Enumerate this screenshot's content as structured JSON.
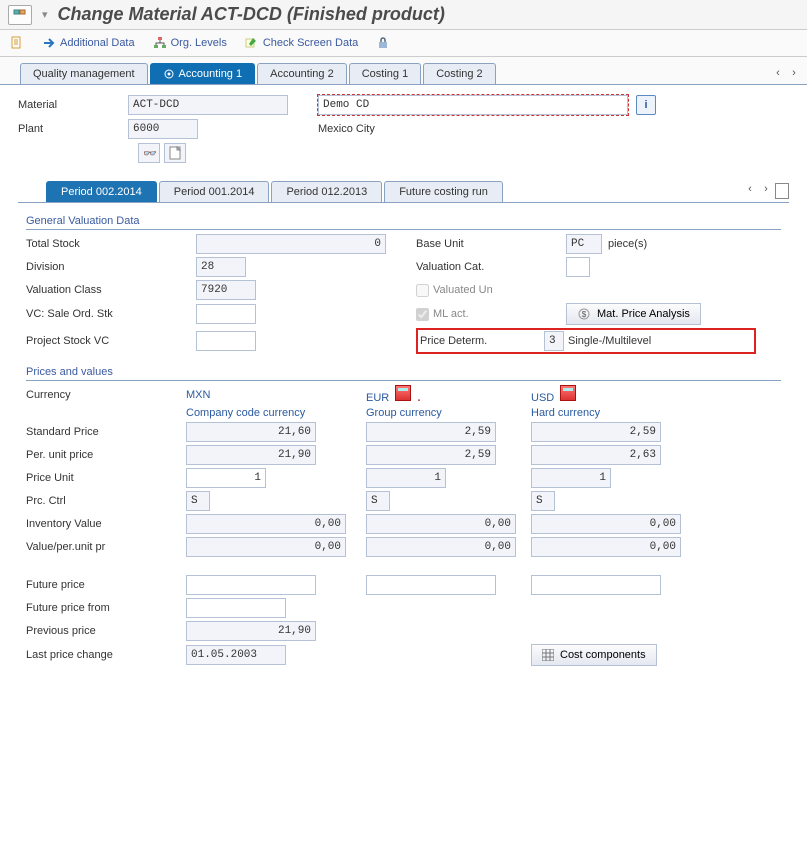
{
  "title": "Change Material ACT-DCD (Finished product)",
  "toolbar": {
    "additional_data": "Additional Data",
    "org_levels": "Org. Levels",
    "check_screen": "Check Screen Data"
  },
  "tabs": {
    "quality": "Quality management",
    "accounting1": "Accounting 1",
    "accounting2": "Accounting 2",
    "costing1": "Costing 1",
    "costing2": "Costing 2"
  },
  "header": {
    "material_lbl": "Material",
    "material_val": "ACT-DCD",
    "material_desc": "Demo CD",
    "plant_lbl": "Plant",
    "plant_val": "6000",
    "plant_desc": "Mexico City"
  },
  "subtabs": {
    "p002": "Period 002.2014",
    "p001": "Period 001.2014",
    "p012": "Period 012.2013",
    "future": "Future costing run"
  },
  "valuation": {
    "title": "General Valuation Data",
    "total_stock_lbl": "Total Stock",
    "total_stock_val": "0",
    "division_lbl": "Division",
    "division_val": "28",
    "valclass_lbl": "Valuation Class",
    "valclass_val": "7920",
    "vc_sale_lbl": "VC: Sale Ord. Stk",
    "vc_sale_val": "",
    "project_lbl": "Project Stock VC",
    "project_val": "",
    "base_unit_lbl": "Base Unit",
    "base_unit_val": "PC",
    "base_unit_text": "piece(s)",
    "valcat_lbl": "Valuation Cat.",
    "valcat_val": "",
    "valuated_un_lbl": "Valuated Un",
    "ml_act_lbl": "ML act.",
    "mat_price_btn": "Mat. Price Analysis",
    "price_determ_lbl": "Price Determ.",
    "price_determ_val": "3",
    "price_determ_text": "Single-/Multilevel"
  },
  "prices": {
    "title": "Prices and values",
    "currency_lbl": "Currency",
    "mxn": "MXN",
    "eur": "EUR",
    "usd": "USD",
    "mxn_sub": "Company code currency",
    "eur_sub": "Group currency",
    "usd_sub": "Hard currency",
    "std_price_lbl": "Standard Price",
    "std_price": {
      "mxn": "21,60",
      "eur": "2,59",
      "usd": "2,59"
    },
    "per_unit_lbl": "Per. unit price",
    "per_unit": {
      "mxn": "21,90",
      "eur": "2,59",
      "usd": "2,63"
    },
    "price_unit_lbl": "Price Unit",
    "price_unit": {
      "mxn": "1",
      "eur": "1",
      "usd": "1"
    },
    "prc_ctrl_lbl": "Prc. Ctrl",
    "prc_ctrl": {
      "mxn": "S",
      "eur": "S",
      "usd": "S"
    },
    "inv_val_lbl": "Inventory Value",
    "inv_val": {
      "mxn": "0,00",
      "eur": "0,00",
      "usd": "0,00"
    },
    "val_per_lbl": "Value/per.unit pr",
    "val_per": {
      "mxn": "0,00",
      "eur": "0,00",
      "usd": "0,00"
    },
    "future_price_lbl": "Future price",
    "future_from_lbl": "Future price from",
    "prev_price_lbl": "Previous price",
    "prev_price_mxn": "21,90",
    "last_change_lbl": "Last price change",
    "last_change_val": "01.05.2003",
    "cost_comp_btn": "Cost components"
  }
}
